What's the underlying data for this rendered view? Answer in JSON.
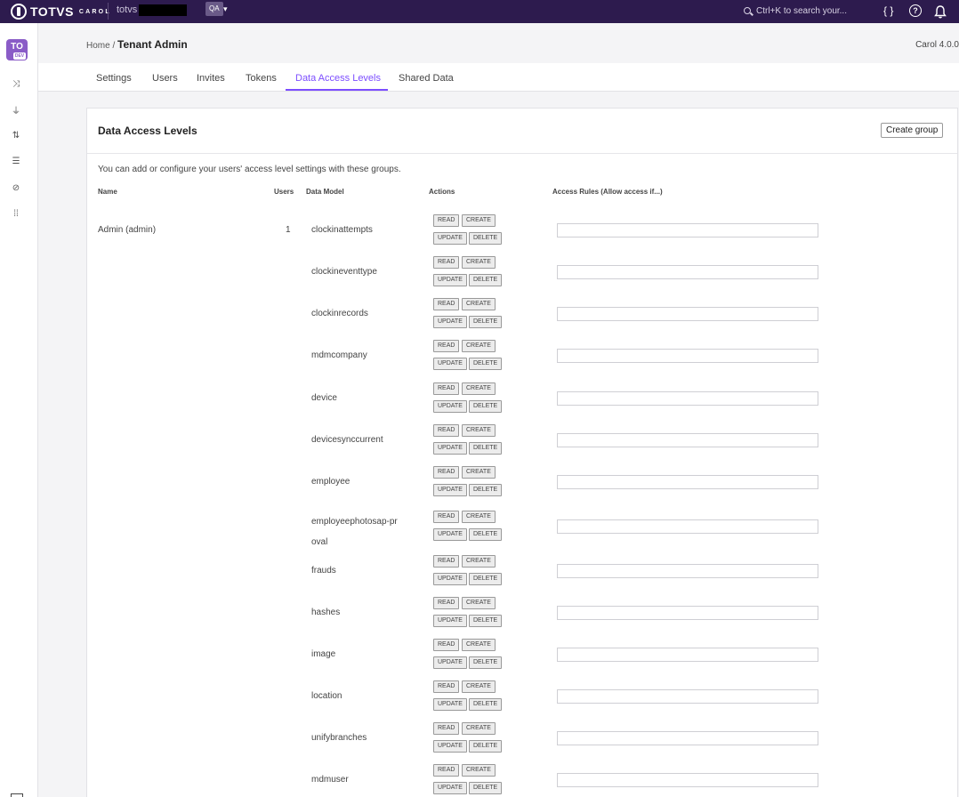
{
  "topbar": {
    "brand": "TOTVS",
    "brand_sub": "CAROL",
    "tenant": "totvs",
    "env": "QA",
    "search_placeholder": "Ctrl+K to search your...",
    "icons": [
      "braces-icon",
      "help-icon",
      "bell-icon"
    ]
  },
  "sidebar": {
    "avatar": "TO",
    "avatar_tag": "DEV",
    "icons": [
      "shuffle-icon",
      "plug-icon",
      "flow-icon",
      "database-icon",
      "compass-icon",
      "apps-icon"
    ]
  },
  "header": {
    "breadcrumb_home": "Home",
    "breadcrumb_sep": "/",
    "title": "Tenant Admin",
    "version": "Carol 4.0.0"
  },
  "tabs": [
    {
      "label": "Settings"
    },
    {
      "label": "Users"
    },
    {
      "label": "Invites"
    },
    {
      "label": "Tokens"
    },
    {
      "label": "Data Access Levels",
      "active": true
    },
    {
      "label": "Shared Data"
    }
  ],
  "card": {
    "title": "Data Access Levels",
    "create_button": "Create group",
    "description": "You can add or configure your users' access level settings with these groups.",
    "columns": {
      "name": "Name",
      "users": "Users",
      "data_model": "Data Model",
      "actions": "Actions",
      "rules": "Access Rules (Allow access if...)"
    },
    "group": {
      "name": "Admin (admin)",
      "users": "1"
    },
    "action_labels": {
      "read": "READ",
      "create": "CREATE",
      "update": "UPDATE",
      "delete": "DELETE"
    },
    "models": [
      {
        "name": "clockinattempts",
        "rule": ""
      },
      {
        "name": "clockineventtype",
        "rule": ""
      },
      {
        "name": "clockinrecords",
        "rule": ""
      },
      {
        "name": "mdmcompany",
        "rule": ""
      },
      {
        "name": "device",
        "rule": ""
      },
      {
        "name": "devicesynccurrent",
        "rule": ""
      },
      {
        "name": "employee",
        "rule": ""
      },
      {
        "name": "employeephotosap-proval",
        "rule": ""
      },
      {
        "name": "frauds",
        "rule": ""
      },
      {
        "name": "hashes",
        "rule": ""
      },
      {
        "name": "image",
        "rule": ""
      },
      {
        "name": "location",
        "rule": ""
      },
      {
        "name": "unifybranches",
        "rule": ""
      },
      {
        "name": "mdmuser",
        "rule": ""
      }
    ]
  }
}
